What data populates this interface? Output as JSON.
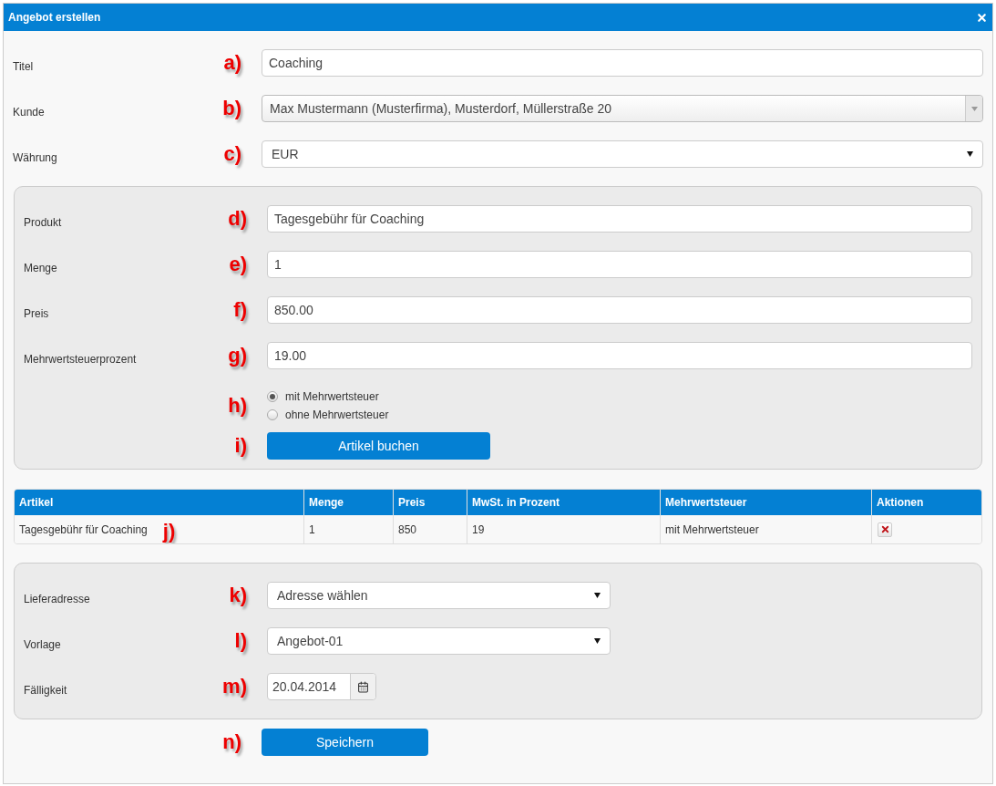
{
  "dialog": {
    "title": "Angebot erstellen"
  },
  "fields": [
    {
      "label": "Titel",
      "marker": "a)",
      "kind": "text",
      "value": "Coaching"
    },
    {
      "label": "Kunde",
      "marker": "b)",
      "kind": "combo",
      "value": "Max Mustermann (Musterfirma), Musterdorf, Müllerstraße 20"
    },
    {
      "label": "Währung",
      "marker": "c)",
      "kind": "select",
      "value": "EUR"
    }
  ],
  "product_panel": {
    "fields": [
      {
        "label": "Produkt",
        "marker": "d)",
        "kind": "text",
        "value": "Tagesgebühr für Coaching"
      },
      {
        "label": "Menge",
        "marker": "e)",
        "kind": "text",
        "value": "1"
      },
      {
        "label": "Preis",
        "marker": "f)",
        "kind": "text",
        "value": "850.00"
      },
      {
        "label": "Mehrwertsteuerprozent",
        "marker": "g)",
        "kind": "text",
        "value": "19.00"
      }
    ],
    "vat_options": {
      "marker": "h)",
      "options": [
        {
          "label": "mit Mehrwertsteuer",
          "selected": true
        },
        {
          "label": "ohne Mehrwertsteuer",
          "selected": false
        }
      ]
    },
    "book_button": {
      "marker": "i)",
      "label": "Artikel buchen"
    }
  },
  "table": {
    "columns": [
      "Artikel",
      "Menge",
      "Preis",
      "MwSt. in Prozent",
      "Mehrwertsteuer",
      "Aktionen"
    ],
    "rows": [
      {
        "marker": "j)",
        "cells": [
          "Tagesgebühr für Coaching",
          "1",
          "850",
          "19",
          "mit Mehrwertsteuer"
        ]
      }
    ]
  },
  "delivery_panel": {
    "fields": [
      {
        "label": "Lieferadresse",
        "marker": "k)",
        "kind": "select",
        "value": "Adresse wählen"
      },
      {
        "label": "Vorlage",
        "marker": "l)",
        "kind": "select",
        "value": "Angebot-01"
      },
      {
        "label": "Fälligkeit",
        "marker": "m)",
        "kind": "date",
        "value": "20.04.2014"
      }
    ]
  },
  "save_button": {
    "marker": "n)",
    "label": "Speichern"
  }
}
